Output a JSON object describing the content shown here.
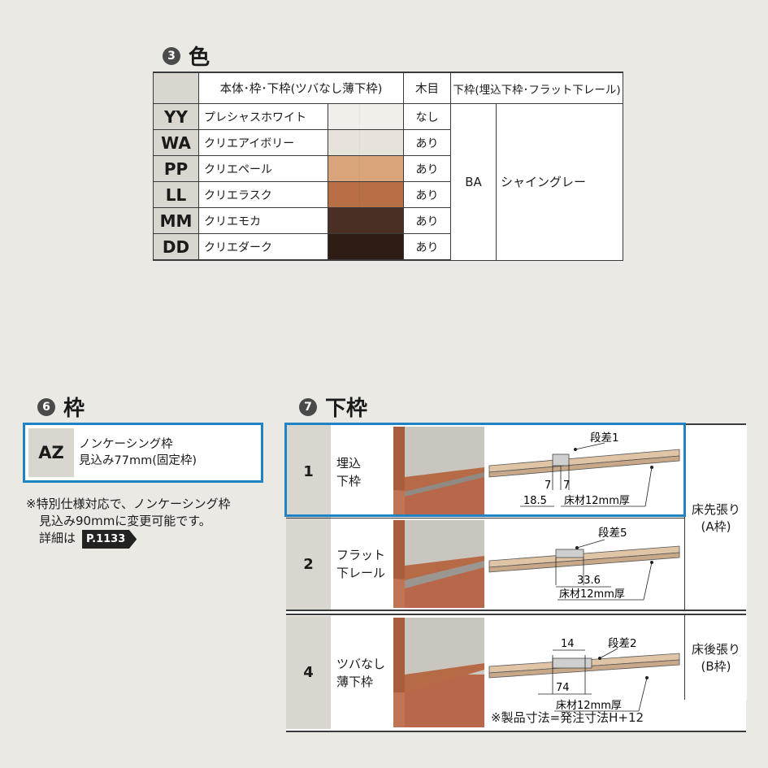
{
  "color_section": {
    "number": "3",
    "title": "色",
    "headers": {
      "body": "本体･枠･下枠(ツバなし薄下枠)",
      "grain": "木目",
      "sill": "下枠(埋込下枠･フラット下レール)"
    },
    "rows": [
      {
        "code": "YY",
        "name": "プレシャスホワイト",
        "grain": "なし",
        "color": "#f2efea"
      },
      {
        "code": "WA",
        "name": "クリエアイボリー",
        "grain": "あり",
        "color": "#e7e3da"
      },
      {
        "code": "PP",
        "name": "クリエペール",
        "grain": "あり",
        "color": "#d9a479"
      },
      {
        "code": "LL",
        "name": "クリエラスク",
        "grain": "あり",
        "color": "#b86f46"
      },
      {
        "code": "MM",
        "name": "クリエモカ",
        "grain": "あり",
        "color": "#4a3024"
      },
      {
        "code": "DD",
        "name": "クリエダーク",
        "grain": "あり",
        "color": "#2e1d15"
      }
    ],
    "sill_code": "BA",
    "sill_name": "シャイングレー"
  },
  "frame_section": {
    "number": "6",
    "title": "枠",
    "code": "AZ",
    "desc_line1": "ノンケーシング枠",
    "desc_line2": "見込み77mm(固定枠)",
    "note_line1": "※特別仕様対応で、ノンケーシング枠",
    "note_line2": "見込み90mmに変更可能です。",
    "note_line3": "詳細は",
    "page_ref": "P.1133"
  },
  "sill_section": {
    "number": "7",
    "title": "下枠",
    "rows": [
      {
        "num": "1",
        "name1": "埋込",
        "name2": "下枠",
        "step": "段差1",
        "d1": "7",
        "d2": "7",
        "d3": "18.5",
        "floor": "床材12mm厚"
      },
      {
        "num": "2",
        "name1": "フラット",
        "name2": "下レール",
        "step": "段差5",
        "d1": "33.6",
        "floor": "床材12mm厚"
      },
      {
        "num": "4",
        "name1": "ツバなし",
        "name2": "薄下枠",
        "step": "段差2",
        "d1": "14",
        "d2": "74",
        "floor": "床材12mm厚"
      }
    ],
    "side_a1": "床先張り",
    "side_a2": "(A枠)",
    "side_b1": "床後張り",
    "side_b2": "(B枠)",
    "footnote": "※製品寸法=発注寸法H+12"
  }
}
